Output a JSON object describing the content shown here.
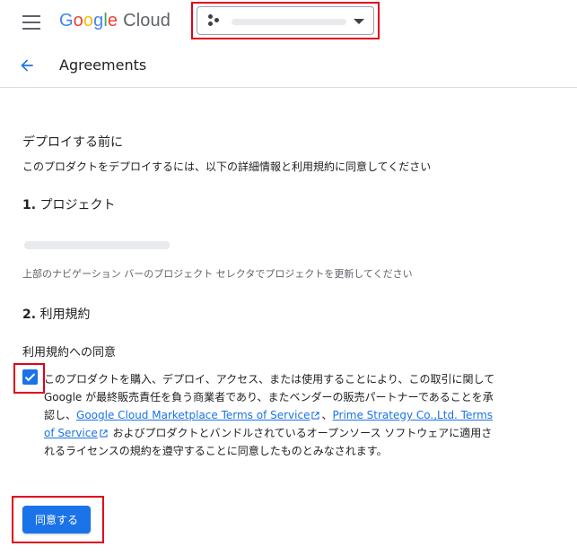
{
  "header": {
    "logo": {
      "g1": "G",
      "g2": "o",
      "g3": "o",
      "g4": "g",
      "g5": "l",
      "g6": "e",
      "cloud": "Cloud"
    },
    "menu_icon": "hamburger-menu-icon",
    "project_selector": {
      "icon": "project-dots-icon",
      "caret_icon": "caret-down-icon"
    }
  },
  "subheader": {
    "back_icon": "arrow-back-icon",
    "title": "Agreements"
  },
  "main": {
    "before_deploy_heading": "デプロイする前に",
    "intro": "このプロダクトをデプロイするには、以下の詳細情報と利用規約に同意してください",
    "step1": {
      "number": "1.",
      "label": "プロジェクト"
    },
    "project_hint": "上部のナビゲーション バーのプロジェクト セレクタでプロジェクトを更新してください",
    "step2": {
      "number": "2.",
      "label": "利用規約"
    },
    "consent_title": "利用規約への同意",
    "consent": {
      "checked": true,
      "text_1": "このプロダクトを購入、デプロイ、アクセス、または使用することにより、この取引に関して Google が最終販売責任を負う商業者であり、またベンダーの販売パートナーであることを承認し、",
      "link_1": "Google Cloud Marketplace Terms of Service",
      "sep": "、",
      "link_2": "Prime Strategy Co.,Ltd. Terms of Service",
      "text_2": " およびプロダクトとバンドルされているオープンソース ソフトウェアに適用されるライセンスの規約を遵守することに同意したものとみなされます。"
    },
    "agree_button": "同意する"
  },
  "colors": {
    "accent": "#1a73e8",
    "highlight": "#e0001b"
  }
}
